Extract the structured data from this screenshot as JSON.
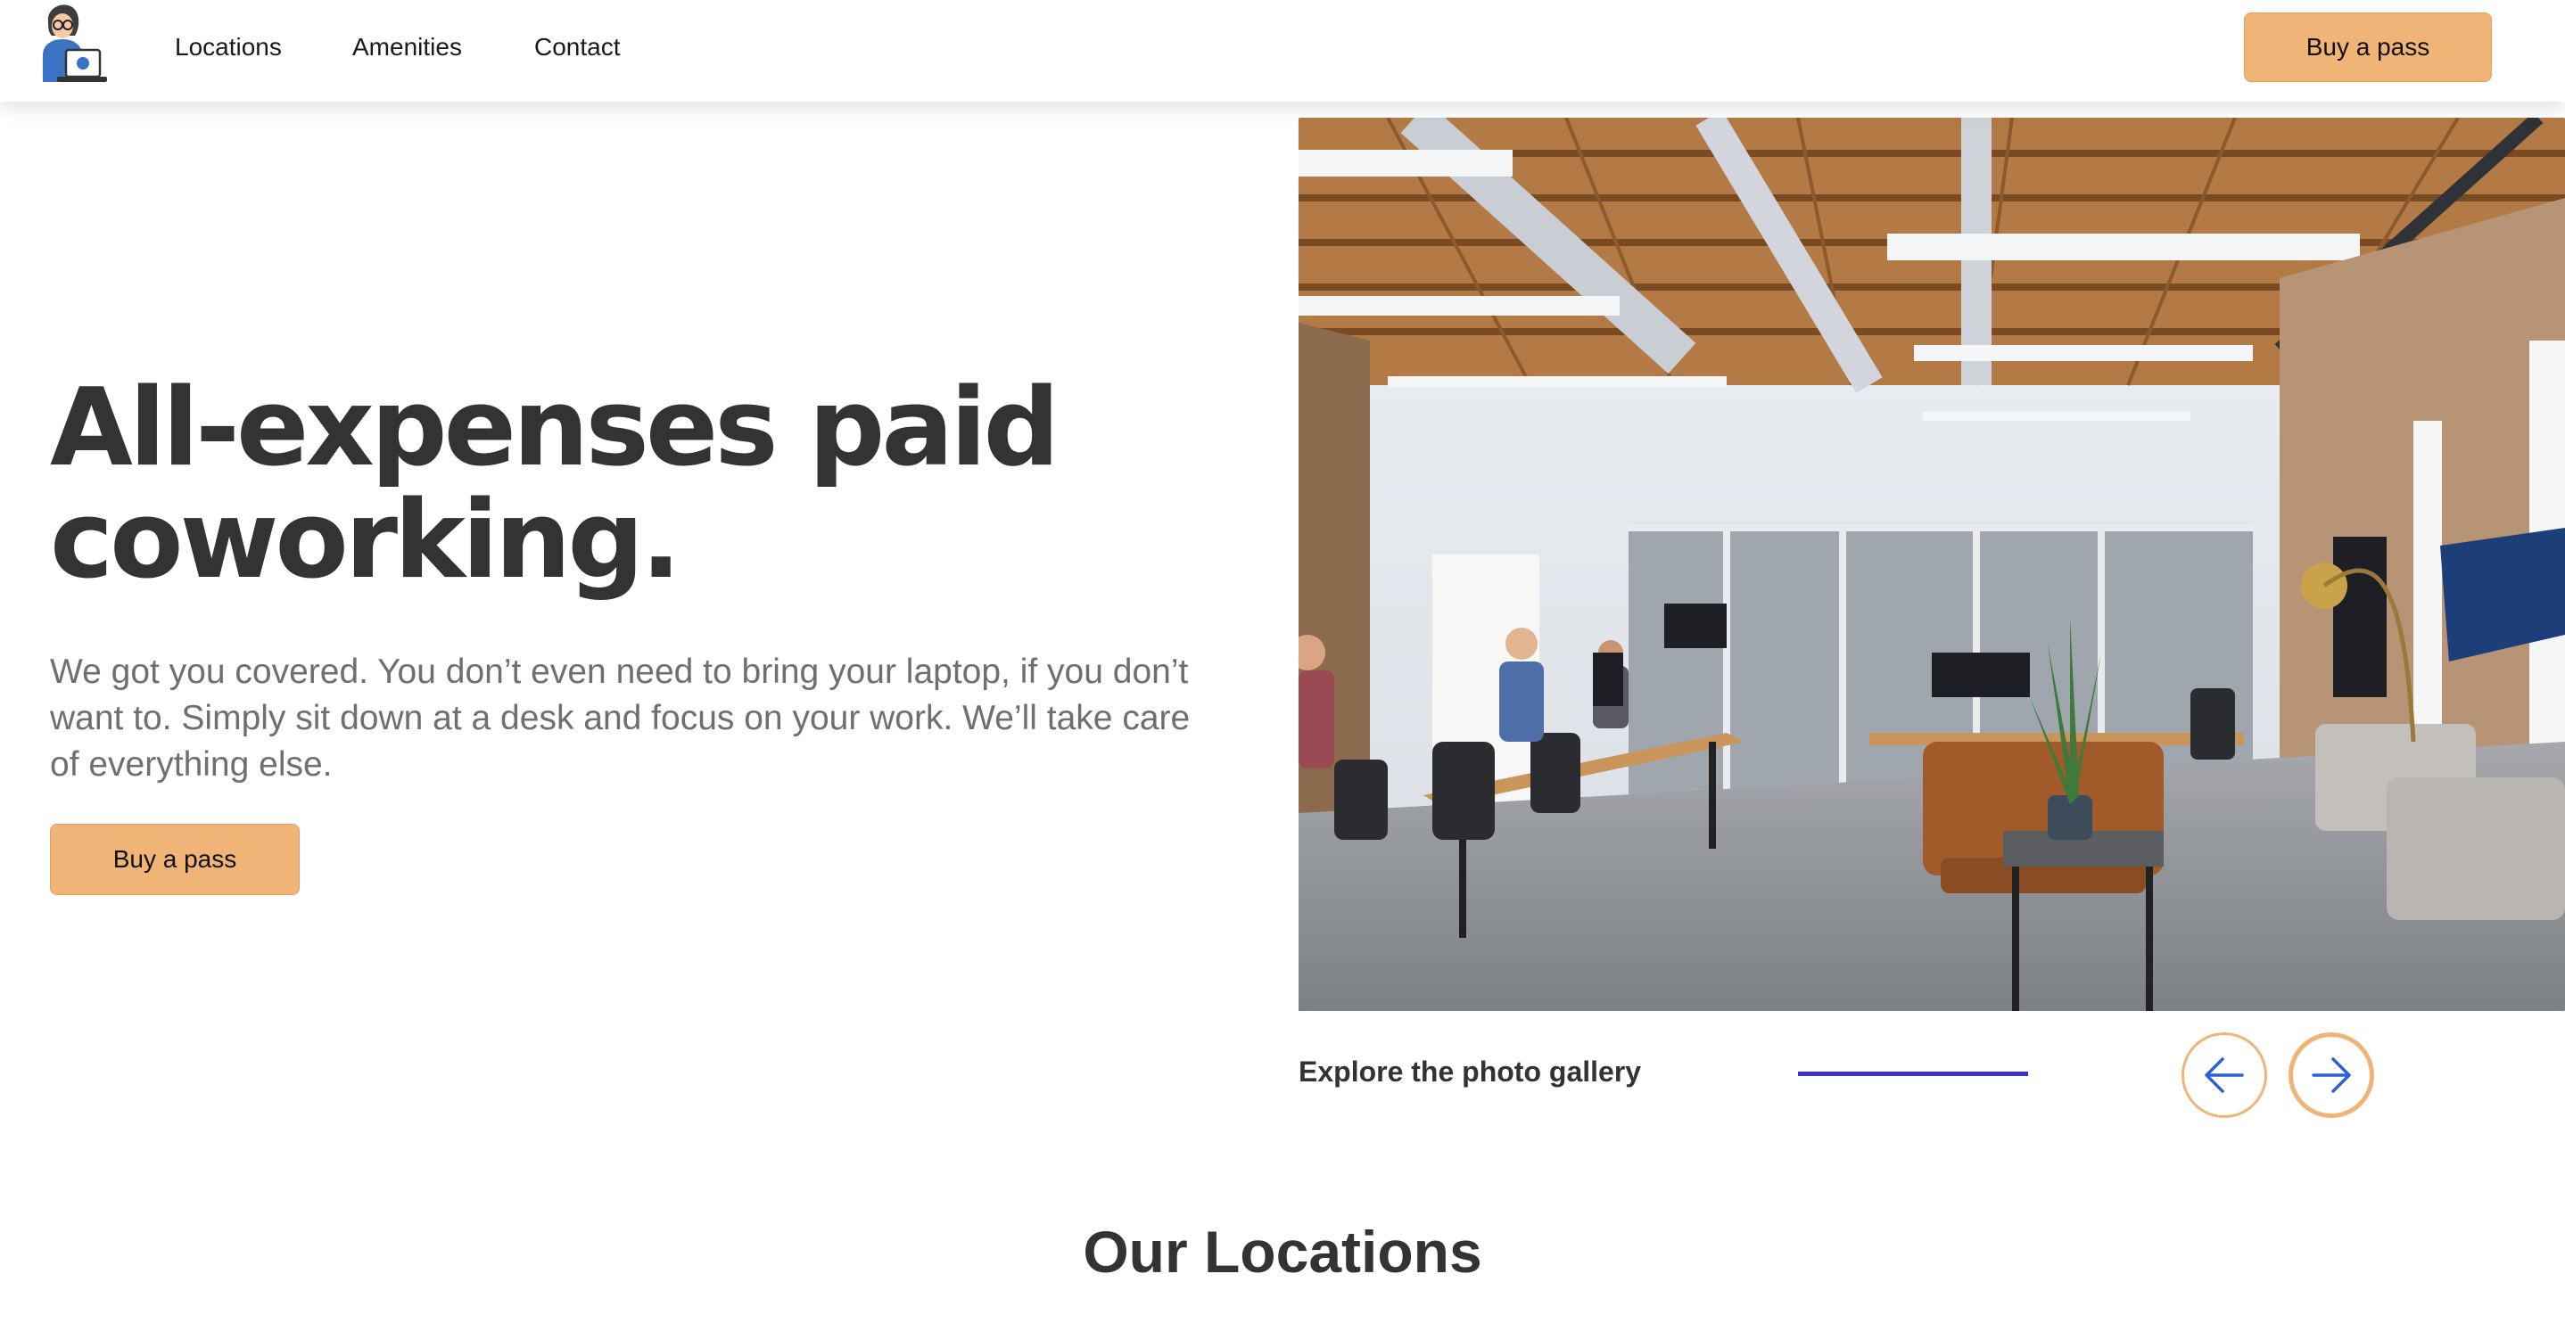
{
  "header": {
    "nav": [
      "Locations",
      "Amenities",
      "Contact"
    ],
    "cta_label": "Buy a pass"
  },
  "hero": {
    "title": "All-expenses paid coworking.",
    "description": "We got you covered. You don’t even need to bring your laptop, if you don’t want to. Simply sit down at a desk and focus on your work. We’ll take care of everything else.",
    "cta_label": "Buy a pass"
  },
  "gallery": {
    "label": "Explore the photo gallery",
    "prev_icon": "arrow-left-icon",
    "next_icon": "arrow-right-icon"
  },
  "locations": {
    "title": "Our Locations"
  },
  "colors": {
    "accent": "#efb476",
    "progress": "#3b32d1",
    "arrow": "#2a63d8",
    "heading": "#333333",
    "body_text": "#6f6f6f"
  }
}
